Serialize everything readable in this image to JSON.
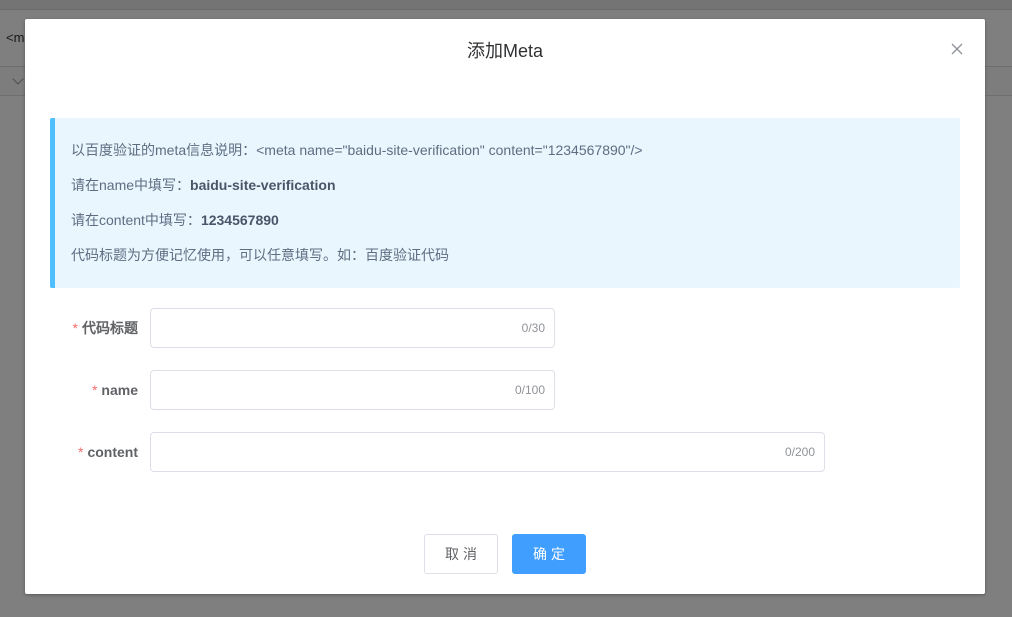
{
  "background": {
    "code_snippet": "<m"
  },
  "dialog": {
    "title": "添加Meta",
    "close_icon": "close-icon"
  },
  "alert": {
    "line1": "以百度验证的meta信息说明：<meta name=\"baidu-site-verification\" content=\"1234567890\"/>",
    "line2_prefix": "请在name中填写：",
    "line2_value": "baidu-site-verification",
    "line3_prefix": "请在content中填写：",
    "line3_value": "1234567890",
    "line4": "代码标题为方便记忆使用，可以任意填写。如：百度验证代码"
  },
  "form": {
    "required_mark": "*",
    "title_field": {
      "label": "代码标题",
      "value": "",
      "counter": "0/30"
    },
    "name_field": {
      "label": "name",
      "value": "",
      "counter": "0/100"
    },
    "content_field": {
      "label": "content",
      "value": "",
      "counter": "0/200"
    }
  },
  "footer": {
    "cancel_label": "取消",
    "confirm_label": "确定"
  },
  "colors": {
    "primary": "#409eff",
    "alert_bg": "#e9f6fe",
    "alert_border": "#50bfff",
    "required": "#f56c6c"
  }
}
